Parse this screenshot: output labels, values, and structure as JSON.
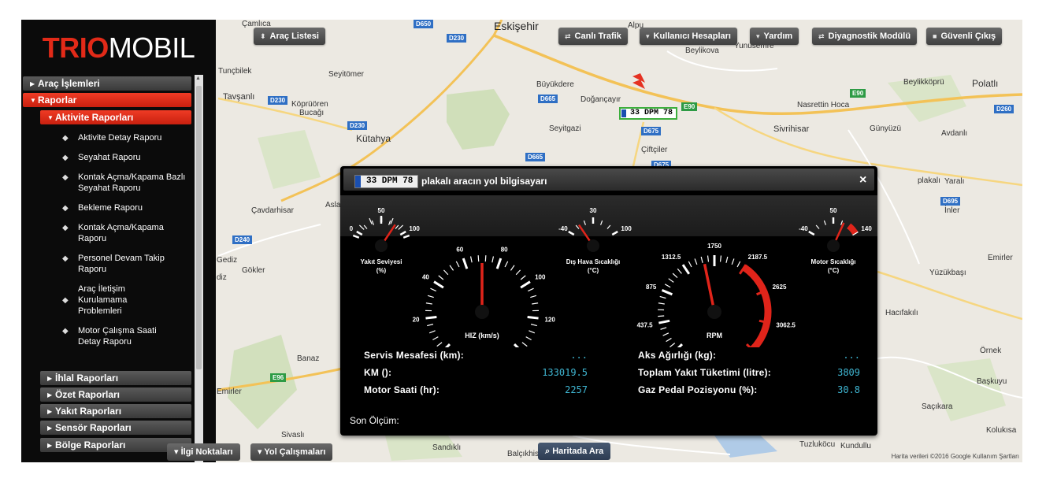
{
  "brand": {
    "red": "TRIO",
    "white": "MOBIL",
    "accent": "#e22a18"
  },
  "menu": {
    "items": [
      {
        "label": "Araç İşlemleri",
        "state": "collapsed"
      },
      {
        "label": "Raporlar",
        "state": "expanded"
      },
      {
        "label": "Aktivite Raporları",
        "state": "expanded"
      },
      {
        "label": "İhlal Raporları",
        "state": "collapsed"
      },
      {
        "label": "Özet Raporları",
        "state": "collapsed"
      },
      {
        "label": "Yakıt Raporları",
        "state": "collapsed"
      },
      {
        "label": "Sensör Raporları",
        "state": "collapsed"
      },
      {
        "label": "Bölge Raporları",
        "state": "collapsed"
      }
    ],
    "activity_reports": [
      "Aktivite Detay Raporu",
      "Seyahat Raporu",
      "Kontak Açma/Kapama Bazlı Seyahat Raporu",
      "Bekleme Raporu",
      "Kontak Açma/Kapama Raporu",
      "Personel Devam Takip Raporu",
      "Araç İletişim Kurulamama Problemleri",
      "Motor Çalışma Saati Detay Raporu"
    ]
  },
  "toolbar": {
    "vehicle_list": "Araç Listesi",
    "live_traffic": "Canlı Trafik",
    "user_accounts": "Kullanıcı Hesapları",
    "help": "Yardım",
    "diagnostic": "Diyagnostik Modülü",
    "logout": "Güvenli Çıkış"
  },
  "bottom_bar": {
    "poi": "İlgi Noktaları",
    "roadworks": "Yol Çalışmaları",
    "search_map": "Haritada Ara"
  },
  "map": {
    "copyright": "Harita verileri ©2016 Google   Kullanım Şartları",
    "vehicle_plate": "33 DPM 78",
    "places": [
      {
        "name": "Eskişehir",
        "big": true
      },
      {
        "name": "Çamlıca"
      },
      {
        "name": "Alpu"
      },
      {
        "name": "Beylikova"
      },
      {
        "name": "Yunusemre"
      },
      {
        "name": "Tunçbilek"
      },
      {
        "name": "Seyitömer"
      },
      {
        "name": "Büyükdere"
      },
      {
        "name": "Doğançayır"
      },
      {
        "name": "Beylikköprü"
      },
      {
        "name": "Polatlı"
      },
      {
        "name": "Tavşanlı"
      },
      {
        "name": "Köprüören"
      },
      {
        "name": "Bucağı"
      },
      {
        "name": "Nasrettin Hoca"
      },
      {
        "name": "Kütahya"
      },
      {
        "name": "Seyitgazi"
      },
      {
        "name": "Sivrihisar"
      },
      {
        "name": "Çiftçiler"
      },
      {
        "name": "Günyüzü"
      },
      {
        "name": "Avdanlı"
      },
      {
        "name": "Yaralı"
      },
      {
        "name": "İnler"
      },
      {
        "name": "Çavdarhisar"
      },
      {
        "name": "Asla"
      },
      {
        "name": "plakalı"
      },
      {
        "name": "Emirler"
      },
      {
        "name": "Yüzükbaşı"
      },
      {
        "name": "Gediz"
      },
      {
        "name": "Gökler"
      },
      {
        "name": "Hacıfakılı"
      },
      {
        "name": "Banaz"
      },
      {
        "name": "Örnek"
      },
      {
        "name": "Başkuyu"
      },
      {
        "name": "Saçıkara"
      },
      {
        "name": "Emirler"
      },
      {
        "name": "Kolukısa"
      },
      {
        "name": "Sivaslı"
      },
      {
        "name": "Sandıklı"
      },
      {
        "name": "Balçıkhisar"
      },
      {
        "name": "Tuzluköcu"
      },
      {
        "name": "Kundullu"
      },
      {
        "name": "diz"
      }
    ],
    "road_signs": [
      "D650",
      "D230",
      "D665",
      "E90",
      "D675",
      "D665",
      "D230",
      "D230",
      "E90",
      "D260",
      "D675",
      "D240",
      "E96",
      "D695"
    ]
  },
  "dialog": {
    "plate": "33 DPM 78",
    "title": "plakalı aracın yol bilgisayarı",
    "close": "×",
    "gauges": {
      "fuel": {
        "label_line1": "Yakıt Seviyesi",
        "label_line2": "(%)",
        "min": 0,
        "max": 100,
        "mid": 50,
        "value": 78
      },
      "outside_temp": {
        "label_line1": "Dış Hava Sıcaklığı",
        "label_line2": "(°C)",
        "min": -40,
        "max": 100,
        "mid": 30,
        "value": -10
      },
      "engine_temp": {
        "label_line1": "Motor Sıcaklığı",
        "label_line2": "(°C)",
        "min": -40,
        "max": 140,
        "mid": 50,
        "value": 87
      },
      "speed": {
        "label": "HIZ (km/s)",
        "min": 0,
        "max": 140,
        "ticks": [
          0,
          20,
          40,
          60,
          80,
          100,
          120,
          140
        ],
        "value": 70
      },
      "rpm": {
        "label": "RPM",
        "min": 0,
        "max": 3500,
        "ticks": [
          0,
          437.5,
          875,
          1312.5,
          1750,
          2187.5,
          2625,
          3062.5,
          3500
        ],
        "value": 1600,
        "redline_start": 2187.5
      }
    },
    "left_fields": [
      {
        "label": "Servis Mesafesi (km):",
        "value": "..."
      },
      {
        "label": "KM ():",
        "value": "133019.5"
      },
      {
        "label": "Motor Saati (hr):",
        "value": "2257"
      }
    ],
    "right_fields": [
      {
        "label": "Aks Ağırlığı (kg):",
        "value": "..."
      },
      {
        "label": "Toplam Yakıt Tüketimi (litre):",
        "value": "3809"
      },
      {
        "label": "Gaz Pedal Pozisyonu (%):",
        "value": "30.8"
      }
    ],
    "last_measure": "Son Ölçüm:"
  }
}
